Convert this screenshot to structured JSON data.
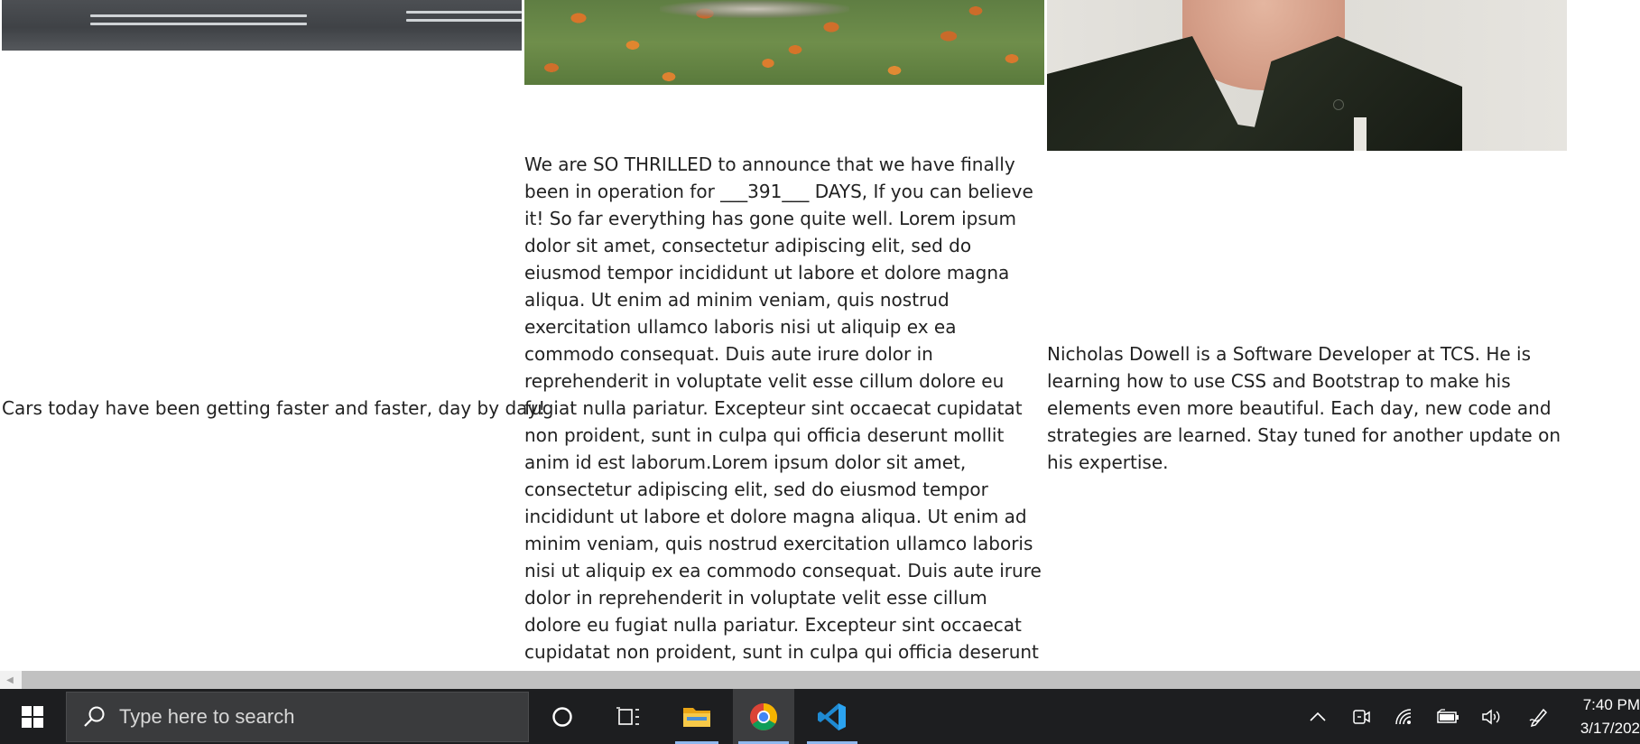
{
  "page": {
    "cars_caption": "Cars today have been getting faster and faster, day by day!",
    "announcement": "We are SO THRILLED to announce that we have finally been in operation for ___391___ DAYS, If you can believe it! So far everything has gone quite well. Lorem ipsum dolor sit amet, consectetur adipiscing elit, sed do eiusmod tempor incididunt ut labore et dolore magna aliqua. Ut enim ad minim veniam, quis nostrud exercitation ullamco laboris nisi ut aliquip ex ea commodo consequat. Duis aute irure dolor in reprehenderit in voluptate velit esse cillum dolore eu fugiat nulla pariatur. Excepteur sint occaecat cupidatat non proident, sunt in culpa qui officia deserunt mollit anim id est laborum.Lorem ipsum dolor sit amet, consectetur adipiscing elit, sed do eiusmod tempor incididunt ut labore et dolore magna aliqua. Ut enim ad minim veniam, quis nostrud exercitation ullamco laboris nisi ut aliquip ex ea commodo consequat. Duis aute irure dolor in reprehenderit in voluptate velit esse cillum dolore eu fugiat nulla pariatur. Excepteur sint occaecat cupidatat non proident, sunt in culpa qui officia deserunt mollit anim id est laborum.",
    "bio": "Nicholas Dowell is a Software Developer at TCS. He is learning how to use CSS and Bootstrap to make his elements even more beautiful. Each day, new code and strategies are learned. Stay tuned for another update on his expertise."
  },
  "taskbar": {
    "search_placeholder": "Type here to search",
    "apps": [
      "cortana-icon",
      "task-view-icon",
      "file-explorer-icon",
      "chrome-icon",
      "vscode-icon"
    ],
    "tray": [
      "chevron-up-icon",
      "meet-now-icon",
      "wifi-icon",
      "battery-icon",
      "volume-icon",
      "pen-icon"
    ],
    "time": "7:40 PM",
    "date": "3/17/202"
  },
  "colors": {
    "taskbar_bg": "#1d1e20",
    "search_bg": "#3a3b3d",
    "active_underline": "#8fb8ee",
    "scrollbar_thumb": "#c1c1c1"
  }
}
